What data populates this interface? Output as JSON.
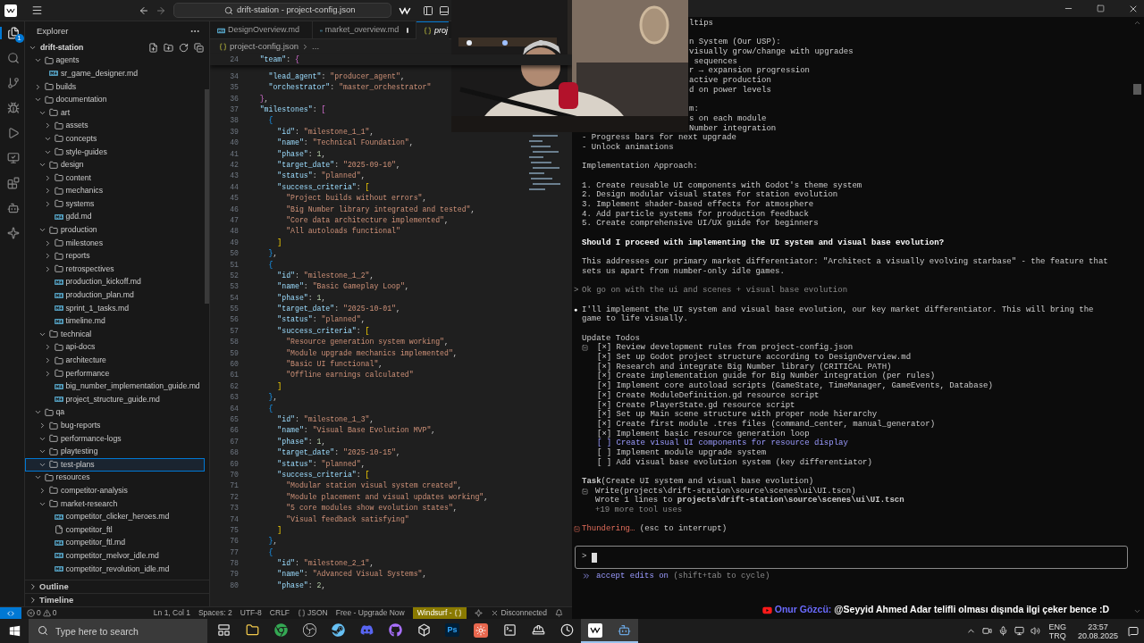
{
  "title_bar": {
    "command_center": "drift-station - project-config.json"
  },
  "activity_bar": {
    "items": [
      {
        "kind": "explorer",
        "selected": true,
        "badge": "1"
      },
      {
        "kind": "search",
        "selected": false
      },
      {
        "kind": "source_control",
        "selected": false
      },
      {
        "kind": "debug",
        "selected": false
      },
      {
        "kind": "run",
        "selected": false
      },
      {
        "kind": "remote",
        "selected": false
      },
      {
        "kind": "extensions",
        "selected": false
      },
      {
        "kind": "robot",
        "selected": false
      },
      {
        "kind": "ai",
        "selected": false
      }
    ]
  },
  "sidebar": {
    "title": "Explorer",
    "tree": {
      "kind": "root",
      "label": "drift-station",
      "expanded": true,
      "selected": false,
      "children": [
        {
          "kind": "folder",
          "label": "agents",
          "expanded": true,
          "selected": false,
          "children": [
            {
              "kind": "md",
              "label": "sr_game_designer.md",
              "selected": false
            }
          ]
        },
        {
          "kind": "folder",
          "label": "builds",
          "expanded": false,
          "selected": false
        },
        {
          "kind": "folder",
          "label": "documentation",
          "expanded": true,
          "selected": false,
          "children": [
            {
              "kind": "folder",
              "label": "art",
              "expanded": true,
              "selected": false,
              "children": [
                {
                  "kind": "folder",
                  "label": "assets",
                  "expanded": false,
                  "selected": false
                },
                {
                  "kind": "folder",
                  "label": "concepts",
                  "expanded": true,
                  "selected": false
                },
                {
                  "kind": "folder",
                  "label": "style-guides",
                  "expanded": true,
                  "selected": false
                }
              ]
            },
            {
              "kind": "folder",
              "label": "design",
              "expanded": true,
              "selected": false,
              "children": [
                {
                  "kind": "folder",
                  "label": "content",
                  "expanded": false,
                  "selected": false
                },
                {
                  "kind": "folder",
                  "label": "mechanics",
                  "expanded": false,
                  "selected": false
                },
                {
                  "kind": "folder",
                  "label": "systems",
                  "expanded": false,
                  "selected": false
                },
                {
                  "kind": "md",
                  "label": "gdd.md",
                  "selected": false
                }
              ]
            },
            {
              "kind": "folder",
              "label": "production",
              "expanded": true,
              "selected": false,
              "children": [
                {
                  "kind": "folder",
                  "label": "milestones",
                  "expanded": false,
                  "selected": false
                },
                {
                  "kind": "folder",
                  "label": "reports",
                  "expanded": false,
                  "selected": false
                },
                {
                  "kind": "folder",
                  "label": "retrospectives",
                  "expanded": false,
                  "selected": false
                },
                {
                  "kind": "md",
                  "label": "production_kickoff.md",
                  "selected": false
                },
                {
                  "kind": "md",
                  "label": "production_plan.md",
                  "selected": false
                },
                {
                  "kind": "md",
                  "label": "sprint_1_tasks.md",
                  "selected": false
                },
                {
                  "kind": "md",
                  "label": "timeline.md",
                  "selected": false
                }
              ]
            },
            {
              "kind": "folder",
              "label": "technical",
              "expanded": true,
              "selected": false,
              "children": [
                {
                  "kind": "folder",
                  "label": "api-docs",
                  "expanded": false,
                  "selected": false
                },
                {
                  "kind": "folder",
                  "label": "architecture",
                  "expanded": false,
                  "selected": false
                },
                {
                  "kind": "folder",
                  "label": "performance",
                  "expanded": false,
                  "selected": false
                },
                {
                  "kind": "md",
                  "label": "big_number_implementation_guide.md",
                  "selected": false
                },
                {
                  "kind": "md",
                  "label": "project_structure_guide.md",
                  "selected": false
                }
              ]
            }
          ]
        },
        {
          "kind": "folder",
          "label": "qa",
          "expanded": true,
          "selected": false,
          "children": [
            {
              "kind": "folder",
              "label": "bug-reports",
              "expanded": false,
              "selected": false
            },
            {
              "kind": "folder",
              "label": "performance-logs",
              "expanded": true,
              "selected": false
            },
            {
              "kind": "folder",
              "label": "playtesting",
              "expanded": true,
              "selected": false
            },
            {
              "kind": "folder",
              "label": "test-plans",
              "expanded": true,
              "selected": true
            }
          ]
        },
        {
          "kind": "folder",
          "label": "resources",
          "expanded": true,
          "selected": false,
          "children": [
            {
              "kind": "folder",
              "label": "competitor-analysis",
              "expanded": false,
              "selected": false
            },
            {
              "kind": "folder",
              "label": "market-research",
              "expanded": true,
              "selected": false,
              "children": [
                {
                  "kind": "md",
                  "label": "competitor_clicker_heroes.md",
                  "selected": false
                },
                {
                  "kind": "file",
                  "label": "competitor_ftl",
                  "selected": false
                },
                {
                  "kind": "md",
                  "label": "competitor_ftl.md",
                  "selected": false
                },
                {
                  "kind": "md",
                  "label": "competitor_melvor_idle.md",
                  "selected": false
                },
                {
                  "kind": "md",
                  "label": "competitor_revolution_idle.md",
                  "selected": false
                }
              ]
            }
          ]
        }
      ]
    },
    "sections": [
      {
        "label": "Outline",
        "expanded": false
      },
      {
        "label": "Timeline",
        "expanded": false
      }
    ]
  },
  "editor": {
    "tabs": [
      {
        "label": "DesignOverview.md",
        "kind": "md",
        "selected": false,
        "dirty": false,
        "preview": false
      },
      {
        "label": "market_overview.md",
        "kind": "md",
        "selected": false,
        "dirty": true,
        "preview": false
      },
      {
        "label": "proj",
        "kind": "json",
        "selected": true,
        "dirty": false,
        "preview": true
      }
    ],
    "breadcrumb": [
      "project-config.json",
      "..."
    ],
    "sticky": {
      "num": "24",
      "text": "    \"team\": {"
    },
    "lines": [
      {
        "num": "34",
        "text": "      \"lead_agent\": \"producer_agent\","
      },
      {
        "num": "35",
        "text": "      \"orchestrator\": \"master_orchestrator\""
      },
      {
        "num": "36",
        "text": "    },"
      },
      {
        "num": "37",
        "text": "    \"milestones\": ["
      },
      {
        "num": "38",
        "text": "      {"
      },
      {
        "num": "39",
        "text": "        \"id\": \"milestone_1_1\","
      },
      {
        "num": "40",
        "text": "        \"name\": \"Technical Foundation\","
      },
      {
        "num": "41",
        "text": "        \"phase\": 1,"
      },
      {
        "num": "42",
        "text": "        \"target_date\": \"2025-09-10\","
      },
      {
        "num": "43",
        "text": "        \"status\": \"planned\","
      },
      {
        "num": "44",
        "text": "        \"success_criteria\": ["
      },
      {
        "num": "45",
        "text": "          \"Project builds without errors\","
      },
      {
        "num": "46",
        "text": "          \"Big Number library integrated and tested\","
      },
      {
        "num": "47",
        "text": "          \"Core data architecture implemented\","
      },
      {
        "num": "48",
        "text": "          \"All autoloads functional\""
      },
      {
        "num": "49",
        "text": "        ]"
      },
      {
        "num": "50",
        "text": "      },"
      },
      {
        "num": "51",
        "text": "      {"
      },
      {
        "num": "52",
        "text": "        \"id\": \"milestone_1_2\","
      },
      {
        "num": "53",
        "text": "        \"name\": \"Basic Gameplay Loop\","
      },
      {
        "num": "54",
        "text": "        \"phase\": 1,"
      },
      {
        "num": "55",
        "text": "        \"target_date\": \"2025-10-01\","
      },
      {
        "num": "56",
        "text": "        \"status\": \"planned\","
      },
      {
        "num": "57",
        "text": "        \"success_criteria\": ["
      },
      {
        "num": "58",
        "text": "          \"Resource generation system working\","
      },
      {
        "num": "59",
        "text": "          \"Module upgrade mechanics implemented\","
      },
      {
        "num": "60",
        "text": "          \"Basic UI functional\","
      },
      {
        "num": "61",
        "text": "          \"Offline earnings calculated\""
      },
      {
        "num": "62",
        "text": "        ]"
      },
      {
        "num": "63",
        "text": "      },"
      },
      {
        "num": "64",
        "text": "      {"
      },
      {
        "num": "65",
        "text": "        \"id\": \"milestone_1_3\","
      },
      {
        "num": "66",
        "text": "        \"name\": \"Visual Base Evolution MVP\","
      },
      {
        "num": "67",
        "text": "        \"phase\": 1,"
      },
      {
        "num": "68",
        "text": "        \"target_date\": \"2025-10-15\","
      },
      {
        "num": "69",
        "text": "        \"status\": \"planned\","
      },
      {
        "num": "70",
        "text": "        \"success_criteria\": ["
      },
      {
        "num": "71",
        "text": "          \"Modular station visual system created\","
      },
      {
        "num": "72",
        "text": "          \"Module placement and visual updates working\","
      },
      {
        "num": "73",
        "text": "          \"5 core modules show evolution states\","
      },
      {
        "num": "74",
        "text": "          \"Visual feedback satisfying\""
      },
      {
        "num": "75",
        "text": "        ]"
      },
      {
        "num": "76",
        "text": "      },"
      },
      {
        "num": "77",
        "text": "      {"
      },
      {
        "num": "78",
        "text": "        \"id\": \"milestone_2_1\","
      },
      {
        "num": "79",
        "text": "        \"name\": \"Advanced Visual Systems\","
      },
      {
        "num": "80",
        "text": "        \"phase\": 2,"
      }
    ]
  },
  "status_bar": {
    "errors": "0",
    "warnings": "0",
    "items": [
      {
        "kind": "text",
        "text": "Ln 1, Col 1"
      },
      {
        "kind": "text",
        "text": "Spaces: 2"
      },
      {
        "kind": "text",
        "text": "UTF-8"
      },
      {
        "kind": "text",
        "text": "CRLF"
      },
      {
        "kind": "language",
        "text": "JSON"
      },
      {
        "kind": "text",
        "text": "Free - Upgrade Now"
      },
      {
        "kind": "highlight",
        "text": "Windsurf -"
      },
      {
        "kind": "disconnected",
        "text": "Disconnected"
      }
    ]
  },
  "terminal": {
    "lines": [
      {
        "kind": "clipped",
        "text": "ltips"
      },
      {
        "kind": "blank"
      },
      {
        "kind": "clipped",
        "text": "n System (Our USP):"
      },
      {
        "kind": "clipped",
        "text": "visually grow/change with upgrades"
      },
      {
        "kind": "clipped",
        "text": " sequences"
      },
      {
        "kind": "clipped",
        "text": "r → expansion progression"
      },
      {
        "kind": "clipped",
        "text": "active production"
      },
      {
        "kind": "clipped",
        "text": "d on power levels"
      },
      {
        "kind": "blank"
      },
      {
        "kind": "clipped",
        "text": "m:"
      },
      {
        "kind": "clipped",
        "text": "s on each module"
      },
      {
        "kind": "clipped",
        "text": "Number integration"
      },
      {
        "kind": "text",
        "text": "- Progress bars for next upgrade"
      },
      {
        "kind": "text",
        "text": "- Unlock animations"
      },
      {
        "kind": "blank"
      },
      {
        "kind": "text",
        "text": "Implementation Approach:"
      },
      {
        "kind": "blank"
      },
      {
        "kind": "text",
        "text": "1. Create reusable UI components with Godot's theme system"
      },
      {
        "kind": "text",
        "text": "2. Design modular visual states for station evolution"
      },
      {
        "kind": "text",
        "text": "3. Implement shader-based effects for atmosphere"
      },
      {
        "kind": "text",
        "text": "4. Add particle systems for production feedback"
      },
      {
        "kind": "text",
        "text": "5. Create comprehensive UI/UX guide for beginners"
      },
      {
        "kind": "blank"
      },
      {
        "kind": "bold",
        "text": "Should I proceed with implementing the UI system and visual base evolution?"
      },
      {
        "kind": "blank"
      },
      {
        "kind": "text",
        "text": "This addresses our primary market differentiator: \"Architect a visually evolving starbase\" - the feature that"
      },
      {
        "kind": "text",
        "text": "sets us apart from number-only idle games."
      },
      {
        "kind": "blank"
      },
      {
        "kind": "user",
        "marker": ">",
        "text": "Ok go on with the ui and scenes + visual base evolution"
      },
      {
        "kind": "blank"
      },
      {
        "kind": "bullet",
        "marker": "●",
        "text": "I'll implement the UI system and visual base evolution, our key market differentiator. This will bring the"
      },
      {
        "kind": "text",
        "text": "game to life visually."
      },
      {
        "kind": "blank"
      },
      {
        "kind": "text",
        "text": "Update Todos"
      },
      {
        "kind": "todo",
        "lead": true,
        "active": false,
        "text": "[×] Review development rules from project-config.json"
      },
      {
        "kind": "todo",
        "lead": false,
        "active": false,
        "text": "[×] Set up Godot project structure according to DesignOverview.md"
      },
      {
        "kind": "todo",
        "lead": false,
        "active": false,
        "text": "[×] Research and integrate Big Number library (CRITICAL PATH)"
      },
      {
        "kind": "todo",
        "lead": false,
        "active": false,
        "text": "[×] Create implementation guide for Big Number integration (per rules)"
      },
      {
        "kind": "todo",
        "lead": false,
        "active": false,
        "text": "[×] Implement core autoload scripts (GameState, TimeManager, GameEvents, Database)"
      },
      {
        "kind": "todo",
        "lead": false,
        "active": false,
        "text": "[×] Create ModuleDefinition.gd resource script"
      },
      {
        "kind": "todo",
        "lead": false,
        "active": false,
        "text": "[×] Create PlayerState.gd resource script"
      },
      {
        "kind": "todo",
        "lead": false,
        "active": false,
        "text": "[×] Set up Main scene structure with proper node hierarchy"
      },
      {
        "kind": "todo",
        "lead": false,
        "active": false,
        "text": "[×] Create first module .tres files (command_center, manual_generator)"
      },
      {
        "kind": "todo",
        "lead": false,
        "active": false,
        "text": "[×] Implement basic resource generation loop"
      },
      {
        "kind": "todo",
        "lead": false,
        "active": true,
        "text": "[ ] Create visual UI components for resource display"
      },
      {
        "kind": "todo",
        "lead": false,
        "active": false,
        "text": "[ ] Implement module upgrade system"
      },
      {
        "kind": "todo",
        "lead": false,
        "active": false,
        "text": "[ ] Add visual base evolution system (key differentiator)"
      },
      {
        "kind": "blank"
      },
      {
        "kind": "text",
        "text": "**Task**(Create UI system and visual base evolution)"
      },
      {
        "kind": "tool",
        "lead": true,
        "text": "Write(projects\\drift-station\\source\\scenes\\ui\\UI.tscn)"
      },
      {
        "kind": "tool",
        "lead": false,
        "text": "Wrote 1 lines to **projects\\drift-station\\source\\scenes\\ui\\UI.tscn**"
      },
      {
        "kind": "tool_dim",
        "text": "+19 more tool uses"
      },
      {
        "kind": "blank"
      },
      {
        "kind": "status",
        "label": "Thundering…",
        "hint": "(esc to interrupt)"
      }
    ],
    "prompt": ">",
    "mode": {
      "label": "accept edits on",
      "hint": "(shift+tab to cycle)"
    }
  },
  "chat": {
    "author": "Onur Gözcü:",
    "message": "@Seyyid Ahmed Adar telifli olması dışında ilgi çeker bence :D"
  },
  "taskbar": {
    "search": {
      "placeholder": "Type here to search"
    },
    "apps": [
      {
        "kind": "task_view",
        "active": false
      },
      {
        "kind": "folder",
        "active": false
      },
      {
        "kind": "browser",
        "active": false
      },
      {
        "kind": "recorder",
        "active": false
      },
      {
        "kind": "steam",
        "active": false
      },
      {
        "kind": "chat",
        "active": false
      },
      {
        "kind": "cat",
        "active": false
      },
      {
        "kind": "cube",
        "active": false
      },
      {
        "kind": "tile",
        "label": "Ps",
        "active": false
      },
      {
        "kind": "burst",
        "active": false
      },
      {
        "kind": "terminal",
        "active": false
      },
      {
        "kind": "helmet",
        "active": false
      },
      {
        "kind": "clock",
        "active": false
      },
      {
        "kind": "wave",
        "active": true
      },
      {
        "kind": "robot",
        "active": true
      }
    ],
    "language": [
      "ENG",
      "TRQ"
    ],
    "time": "23:57",
    "date": "20.08.2025"
  }
}
